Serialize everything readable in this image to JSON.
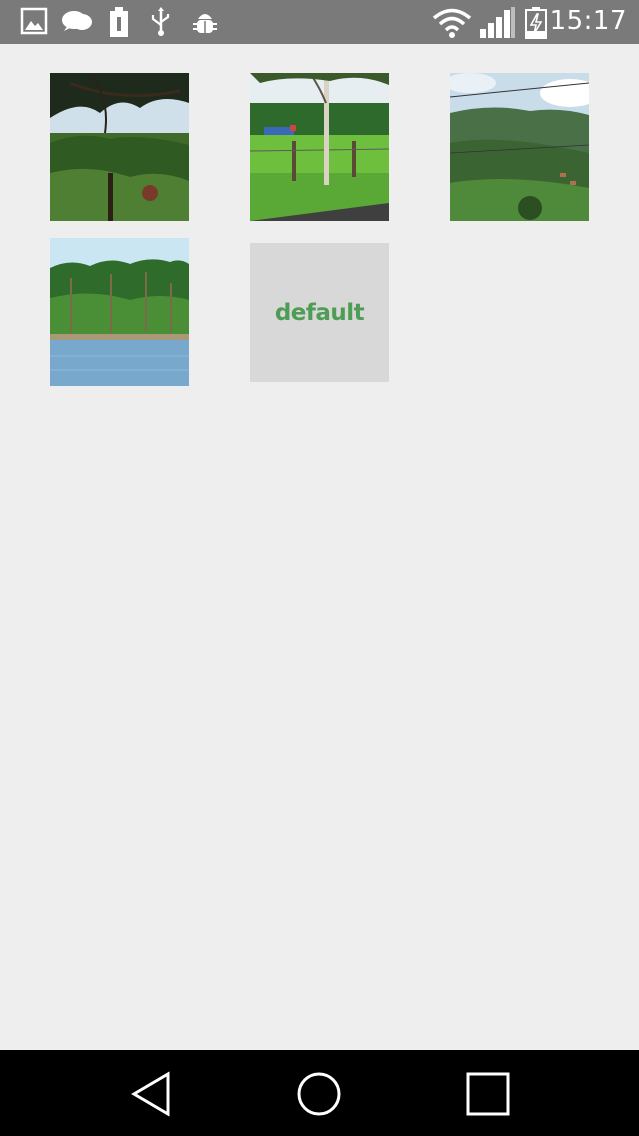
{
  "status_bar": {
    "time": "15:17",
    "left_icons": [
      "gallery-icon",
      "chat-icon",
      "battery-saver-icon",
      "usb-icon",
      "debug-icon"
    ],
    "right_icons": [
      "wifi-icon",
      "signal-icon",
      "battery-charging-icon"
    ],
    "background": "#7a7a7a"
  },
  "gallery": {
    "images": [
      {
        "name": "forest-pine-image"
      },
      {
        "name": "field-fence-image"
      },
      {
        "name": "mountain-hillside-image"
      },
      {
        "name": "palm-beach-image"
      }
    ],
    "default_tile": {
      "label": "default",
      "color": "#4f9d55"
    }
  },
  "nav_bar": {
    "buttons": [
      "back-button",
      "home-button",
      "recents-button"
    ]
  }
}
